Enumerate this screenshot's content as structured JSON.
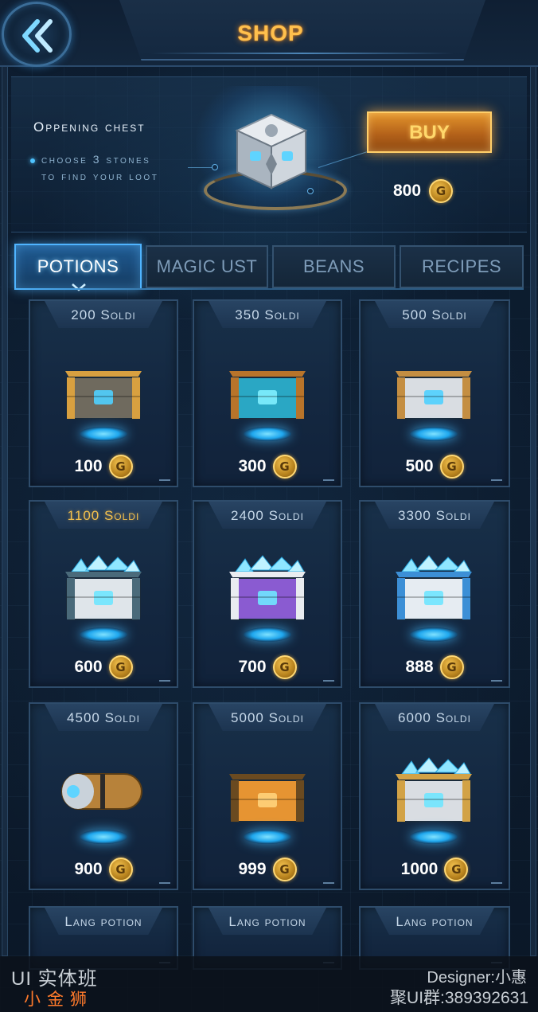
{
  "header": {
    "title": "SHOP"
  },
  "featured": {
    "title": "Oppening chest",
    "desc_line1": "choose 3 stones",
    "desc_line2": "to find your loot",
    "buy_label": "BUY",
    "price": "800"
  },
  "tabs": [
    {
      "label": "POTIONS",
      "active": true
    },
    {
      "label": "MAGIC UST",
      "active": false
    },
    {
      "label": "BEANS",
      "active": false
    },
    {
      "label": "RECIPES",
      "active": false
    }
  ],
  "items": [
    {
      "title": "200 Soldi",
      "price": "100",
      "icon": "gold-crate-icon"
    },
    {
      "title": "350 Soldi",
      "price": "300",
      "icon": "cyan-crate-icon"
    },
    {
      "title": "500 Soldi",
      "price": "500",
      "icon": "white-crate-icon"
    },
    {
      "title": "1100 Soldi",
      "price": "600",
      "icon": "open-gem-chest-icon",
      "highlight": true
    },
    {
      "title": "2400 Soldi",
      "price": "700",
      "icon": "purple-gem-chest-icon"
    },
    {
      "title": "3300 Soldi",
      "price": "888",
      "icon": "blue-gem-chest-icon"
    },
    {
      "title": "4500 Soldi",
      "price": "900",
      "icon": "capsule-icon"
    },
    {
      "title": "5000 Soldi",
      "price": "999",
      "icon": "orange-crate-icon"
    },
    {
      "title": "6000 Soldi",
      "price": "1000",
      "icon": "gold-gem-chest-icon"
    },
    {
      "title": "Lang potion"
    },
    {
      "title": "Lang potion"
    },
    {
      "title": "Lang potion"
    }
  ],
  "watermark": {
    "course": "UI 实体班",
    "author": "小金狮",
    "designer": "Designer:小惠",
    "group": "聚UI群:389392631"
  },
  "colors": {
    "accent": "#4fb4ff",
    "gold": "#ffc04d",
    "buy": "#e4952c"
  }
}
